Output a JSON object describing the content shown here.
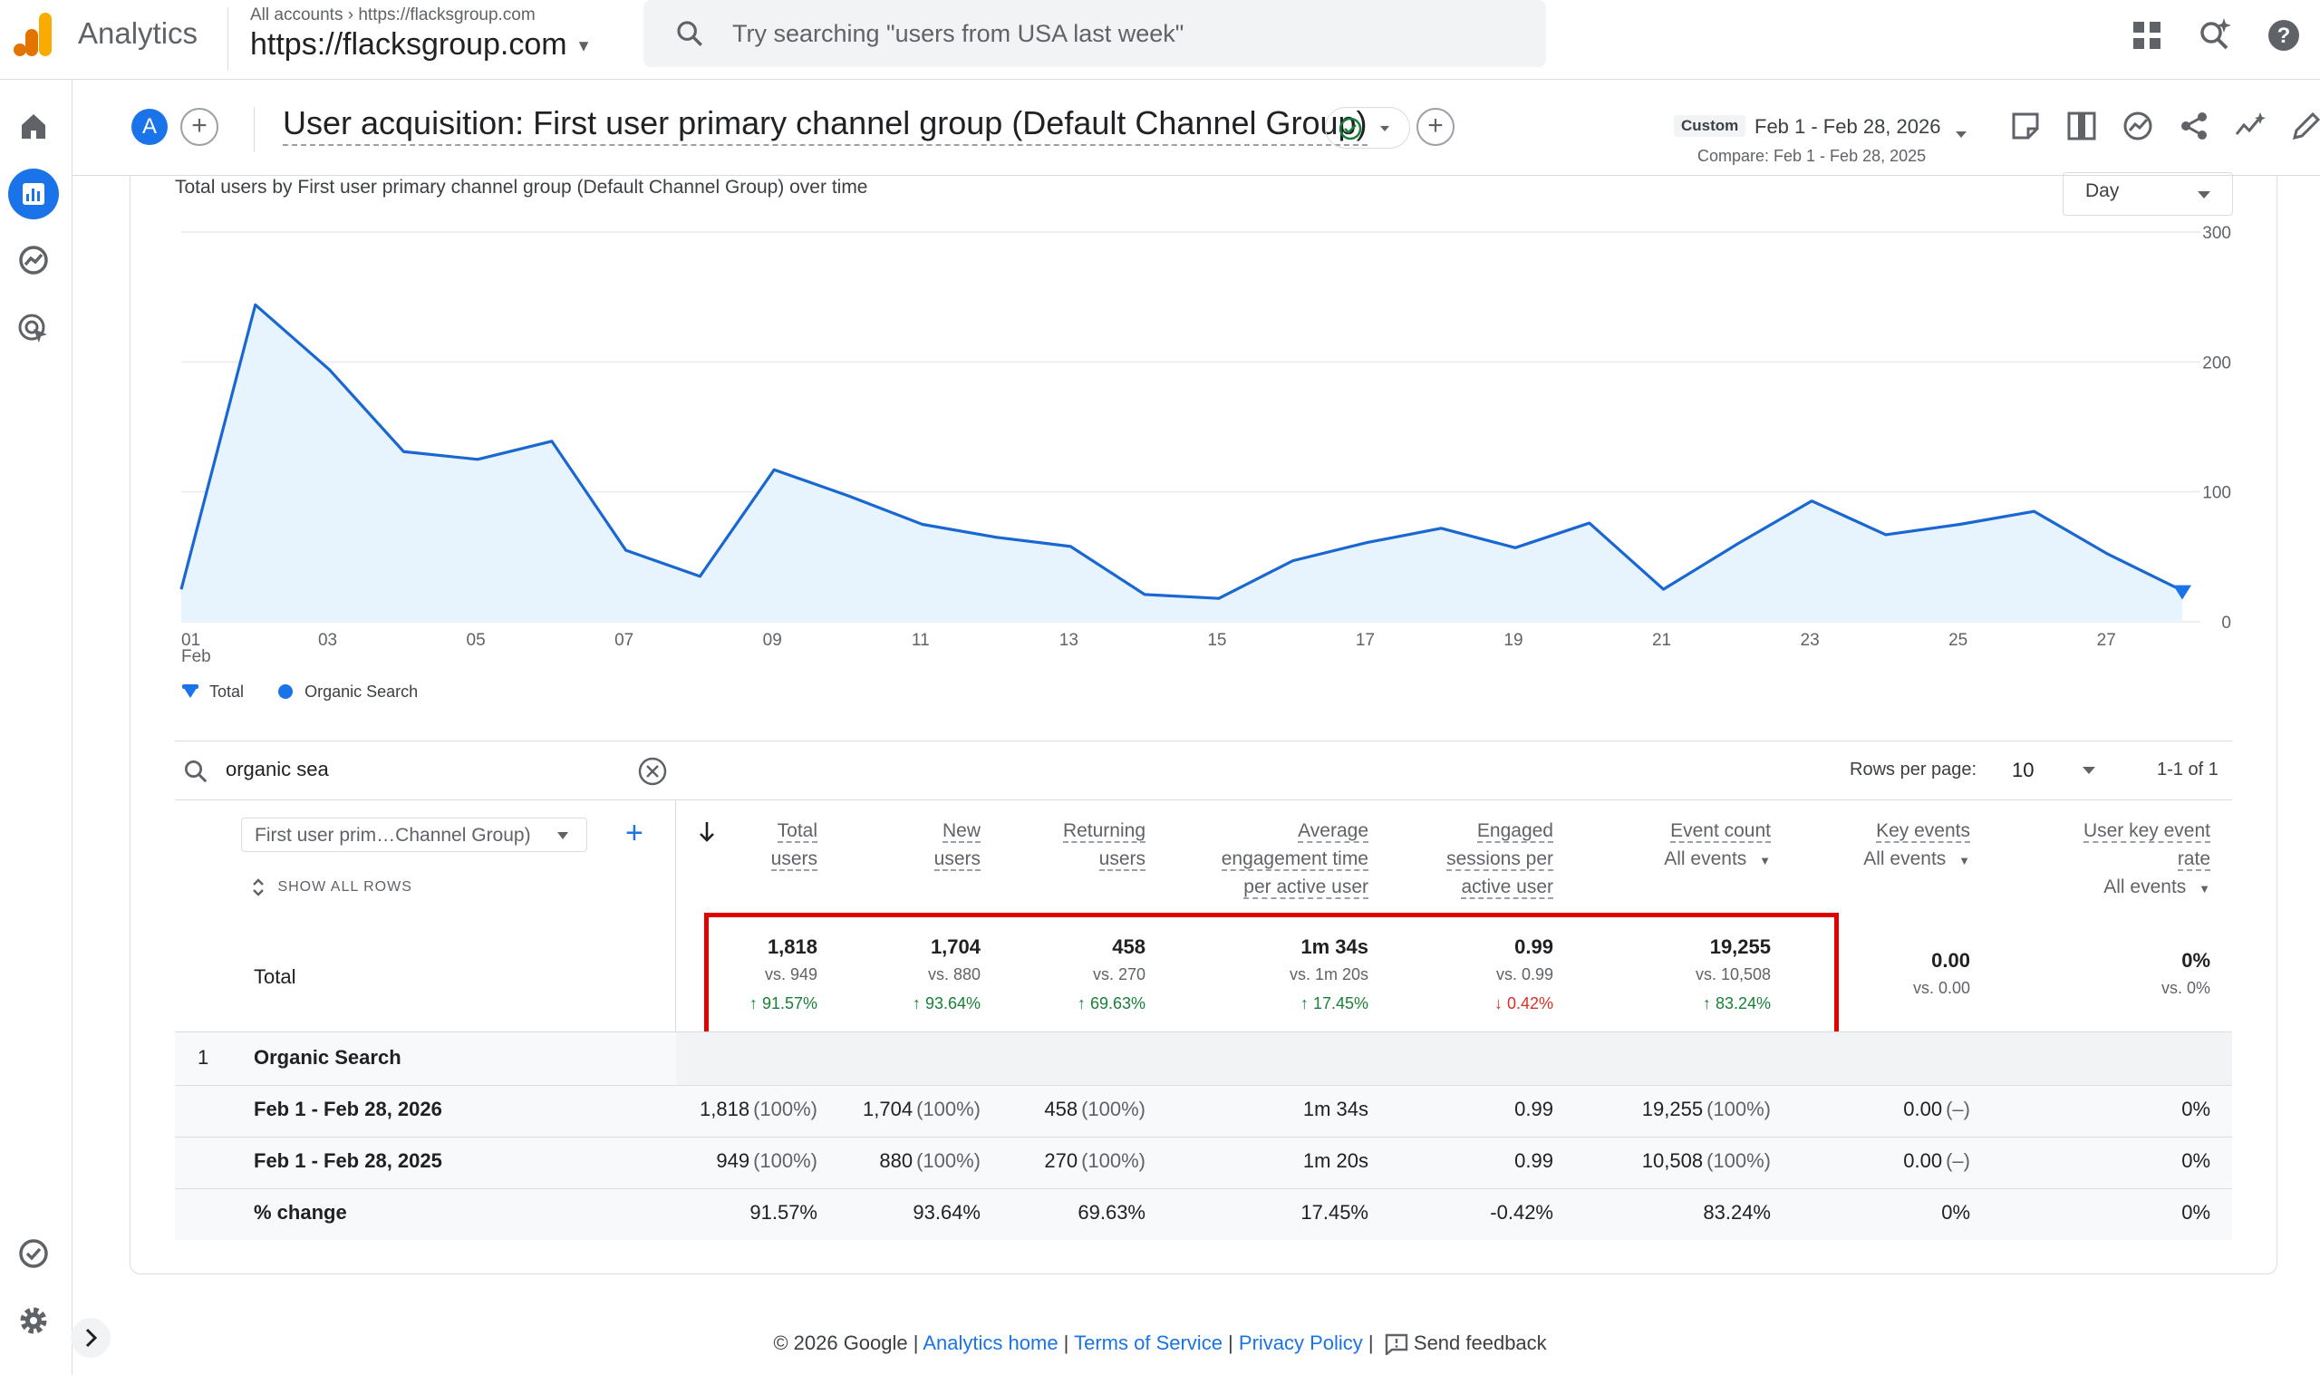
{
  "app": {
    "brand": "Analytics",
    "account_crumb_root": "All accounts",
    "account_crumb_property": "https://flacksgroup.com",
    "account_name": "https://flacksgroup.com",
    "search_placeholder": "Try searching \"users from USA last week\""
  },
  "header": {
    "avatar_letter": "A",
    "title": "User acquisition: First user primary channel group (Default Channel Group)",
    "custom_label": "Custom",
    "date_range": "Feb 1 - Feb 28, 2026",
    "compare_range": "Compare: Feb 1 - Feb 28, 2025"
  },
  "chart": {
    "title": "Total users by First user primary channel group (Default Channel Group) over time",
    "granularity": "Day",
    "legend": [
      "Total",
      "Organic Search"
    ],
    "color_line": "#1967d2",
    "color_fill": "#e8f4fd"
  },
  "chart_data": {
    "type": "area",
    "title": "Total users by First user primary channel group (Default Channel Group) over time",
    "x": [
      "01",
      "02",
      "03",
      "04",
      "05",
      "06",
      "07",
      "08",
      "09",
      "10",
      "11",
      "12",
      "13",
      "14",
      "15",
      "16",
      "17",
      "18",
      "19",
      "20",
      "21",
      "22",
      "23",
      "24",
      "25",
      "26",
      "27",
      "28"
    ],
    "x_tick_labels": [
      "01",
      "03",
      "05",
      "07",
      "09",
      "11",
      "13",
      "15",
      "17",
      "19",
      "21",
      "23",
      "25",
      "27"
    ],
    "x_sub_label": "Feb",
    "y_ticks": [
      "0",
      "100",
      "200",
      "300"
    ],
    "ylim": [
      0,
      300
    ],
    "series": [
      {
        "name": "Organic Search",
        "values": [
          25,
          244,
          194,
          131,
          125,
          139,
          55,
          35,
          117,
          97,
          75,
          65,
          58,
          21,
          18,
          47,
          61,
          72,
          57,
          76,
          25,
          60,
          93,
          67,
          75,
          85,
          52,
          24
        ]
      }
    ],
    "grid": true,
    "legend_position": "bottom-left"
  },
  "table": {
    "search_value": "organic sea",
    "rows_per_page_label": "Rows per page:",
    "rows_per_page": "10",
    "pager": "1-1 of 1",
    "dimension_label": "First user prim…Channel Group)",
    "show_all_rows": "SHOW ALL ROWS",
    "columns": [
      {
        "l1": "Total",
        "l2": "users",
        "l3": ""
      },
      {
        "l1": "New",
        "l2": "users",
        "l3": ""
      },
      {
        "l1": "Returning",
        "l2": "users",
        "l3": ""
      },
      {
        "l1": "Average",
        "l2": "engagement time",
        "l3": "per active user"
      },
      {
        "l1": "Engaged",
        "l2": "sessions per",
        "l3": "active user"
      },
      {
        "l1": "Event count",
        "l2": "",
        "l3": ""
      },
      {
        "l1": "Key events",
        "l2": "",
        "l3": ""
      },
      {
        "l1": "User key event",
        "l2": "rate",
        "l3": ""
      }
    ],
    "event_filter": "All events",
    "totals_label": "Total",
    "totals": [
      {
        "value": "1,818",
        "compare": "vs. 949",
        "change": "91.57%",
        "dir": "up"
      },
      {
        "value": "1,704",
        "compare": "vs. 880",
        "change": "93.64%",
        "dir": "up"
      },
      {
        "value": "458",
        "compare": "vs. 270",
        "change": "69.63%",
        "dir": "up"
      },
      {
        "value": "1m 34s",
        "compare": "vs. 1m 20s",
        "change": "17.45%",
        "dir": "up"
      },
      {
        "value": "0.99",
        "compare": "vs. 0.99",
        "change": "0.42%",
        "dir": "down"
      },
      {
        "value": "19,255",
        "compare": "vs. 10,508",
        "change": "83.24%",
        "dir": "up"
      },
      {
        "value": "0.00",
        "compare": "vs. 0.00",
        "change": "",
        "dir": ""
      },
      {
        "value": "0%",
        "compare": "vs. 0%",
        "change": "",
        "dir": ""
      }
    ],
    "group": {
      "index": "1",
      "name": "Organic Search"
    },
    "rows": [
      {
        "label": "Feb 1 - Feb 28, 2026",
        "cells": [
          [
            "1,818",
            "(100%)"
          ],
          [
            "1,704",
            "(100%)"
          ],
          [
            "458",
            "(100%)"
          ],
          [
            "1m 34s",
            ""
          ],
          [
            "0.99",
            ""
          ],
          [
            "19,255",
            "(100%)"
          ],
          [
            "0.00",
            "(–)"
          ],
          [
            "0%",
            ""
          ]
        ]
      },
      {
        "label": "Feb 1 - Feb 28, 2025",
        "cells": [
          [
            "949",
            "(100%)"
          ],
          [
            "880",
            "(100%)"
          ],
          [
            "270",
            "(100%)"
          ],
          [
            "1m 20s",
            ""
          ],
          [
            "0.99",
            ""
          ],
          [
            "10,508",
            "(100%)"
          ],
          [
            "0.00",
            "(–)"
          ],
          [
            "0%",
            ""
          ]
        ]
      },
      {
        "label": "% change",
        "cells": [
          [
            "91.57%",
            ""
          ],
          [
            "93.64%",
            ""
          ],
          [
            "69.63%",
            ""
          ],
          [
            "17.45%",
            ""
          ],
          [
            "-0.42%",
            ""
          ],
          [
            "83.24%",
            ""
          ],
          [
            "0%",
            ""
          ],
          [
            "0%",
            ""
          ]
        ]
      }
    ]
  },
  "footer": {
    "copyright": "© 2026 Google",
    "links": [
      "Analytics home",
      "Terms of Service",
      "Privacy Policy"
    ],
    "feedback": "Send feedback"
  }
}
